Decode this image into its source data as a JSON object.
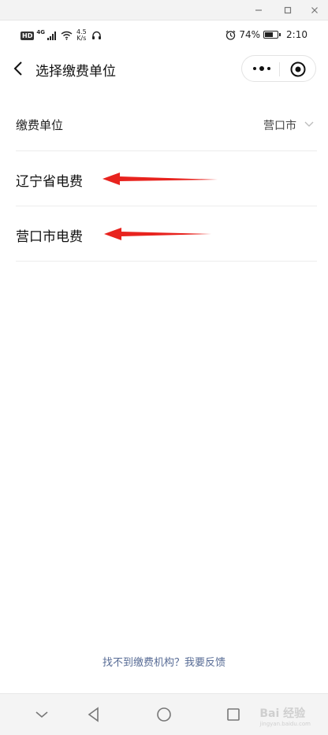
{
  "window": {
    "minimize_icon": "minimize-icon",
    "maximize_icon": "maximize-icon",
    "close_icon": "close-icon"
  },
  "status_bar": {
    "hd": "HD",
    "network": "4G",
    "speed_value": "4.5",
    "speed_unit": "K/s",
    "battery_percent": "74%",
    "battery_level": 0.74,
    "time": "2:10"
  },
  "header": {
    "title": "选择缴费单位"
  },
  "unit_selector": {
    "label": "缴费单位",
    "value": "营口市"
  },
  "items": [
    {
      "label": "辽宁省电费"
    },
    {
      "label": "营口市电费"
    }
  ],
  "footer": {
    "feedback": "找不到缴费机构？我要反馈"
  },
  "watermark": {
    "text": "Bai 经验",
    "sub": "jingyan.baidu.com"
  },
  "colors": {
    "link": "#576b95",
    "arrow": "#e8231e"
  }
}
